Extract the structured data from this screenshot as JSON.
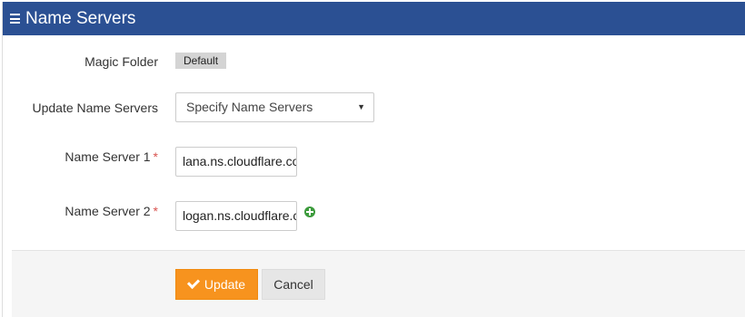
{
  "header": {
    "icon": "menu-icon",
    "title": "Name Servers"
  },
  "form": {
    "magic_folder": {
      "label": "Magic Folder",
      "value": "Default"
    },
    "update_name_servers": {
      "label": "Update Name Servers",
      "selected": "Specify Name Servers"
    },
    "name_server_1": {
      "label": "Name Server 1",
      "required_mark": "*",
      "value": "lana.ns.cloudflare.com"
    },
    "name_server_2": {
      "label": "Name Server 2",
      "required_mark": "*",
      "value": "logan.ns.cloudflare.com",
      "add_icon": "plus-circle-icon"
    }
  },
  "footer": {
    "update_label": "Update",
    "update_icon": "check-icon",
    "cancel_label": "Cancel"
  },
  "colors": {
    "header_bg": "#2b5093",
    "update_bg": "#f7931e",
    "required": "#d9534f",
    "add_icon": "#3c9b3c"
  }
}
